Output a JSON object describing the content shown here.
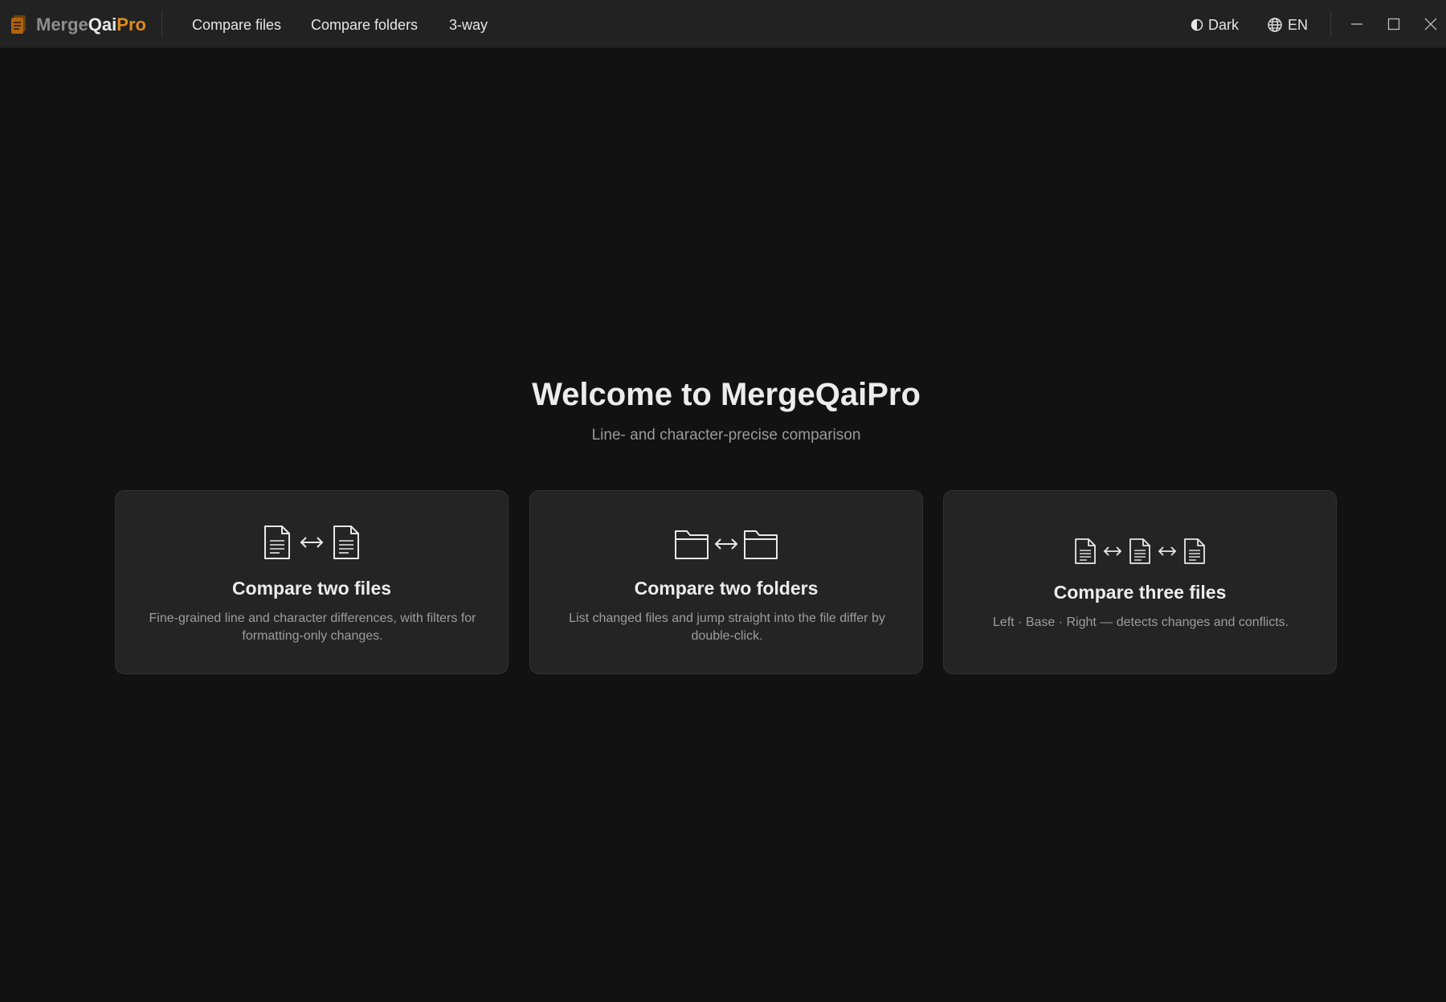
{
  "app": {
    "brand_part1": "Merge",
    "brand_part2": "Qai",
    "brand_part3": "Pro",
    "logo_icon": "document-stack-icon"
  },
  "nav": {
    "items": [
      {
        "label": "Compare files"
      },
      {
        "label": "Compare folders"
      },
      {
        "label": "3-way"
      }
    ]
  },
  "toolbar": {
    "theme_label": "Dark",
    "theme_icon": "contrast-icon",
    "lang_label": "EN",
    "lang_icon": "globe-icon"
  },
  "window_controls": [
    "minimize-icon",
    "maximize-icon",
    "close-icon"
  ],
  "welcome": {
    "title": "Welcome to MergeQaiPro",
    "subtitle": "Line- and character-precise comparison"
  },
  "cards": [
    {
      "title": "Compare two files",
      "description": "Fine-grained line and character differences, with filters for formatting-only changes.",
      "icons": [
        "file-icon",
        "double-arrow-icon",
        "file-icon"
      ]
    },
    {
      "title": "Compare two folders",
      "description": "List changed files and jump straight into the file differ by double-click.",
      "icons": [
        "folder-icon",
        "double-arrow-icon",
        "folder-icon"
      ]
    },
    {
      "title": "Compare three files",
      "description": "Left · Base · Right — detects changes and conflicts.",
      "icons": [
        "file-icon",
        "double-arrow-icon",
        "file-icon",
        "double-arrow-icon",
        "file-icon"
      ]
    }
  ],
  "colors": {
    "background": "#121212",
    "titlebar": "#222222",
    "card": "#242424",
    "accent": "#e08a1e"
  }
}
